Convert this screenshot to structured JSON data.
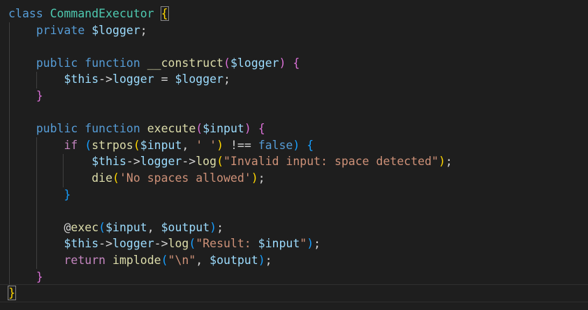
{
  "editor": {
    "language": "php",
    "colors": {
      "background": "#1e1e1e",
      "keyword": "#569cd6",
      "class_name": "#4ec9b0",
      "variable": "#9cdcfe",
      "function": "#dcdcaa",
      "string": "#ce9178",
      "control": "#c586c0",
      "bracket_level_1": "#ffd700",
      "bracket_level_2": "#da70d6",
      "bracket_level_3": "#179fff"
    },
    "lines": [
      [
        [
          "kw",
          "class"
        ],
        [
          "plain",
          " "
        ],
        [
          "cls",
          "CommandExecutor"
        ],
        [
          "plain",
          " "
        ],
        [
          "b1",
          "{"
        ]
      ],
      [
        [
          "plain",
          "    "
        ],
        [
          "kw",
          "private"
        ],
        [
          "plain",
          " "
        ],
        [
          "var",
          "$logger"
        ],
        [
          "plain",
          ";"
        ]
      ],
      [],
      [
        [
          "plain",
          "    "
        ],
        [
          "kw",
          "public"
        ],
        [
          "plain",
          " "
        ],
        [
          "kw",
          "function"
        ],
        [
          "plain",
          " "
        ],
        [
          "fn",
          "__construct"
        ],
        [
          "b2",
          "("
        ],
        [
          "var",
          "$logger"
        ],
        [
          "b2",
          ")"
        ],
        [
          "plain",
          " "
        ],
        [
          "b2",
          "{"
        ]
      ],
      [
        [
          "plain",
          "        "
        ],
        [
          "var",
          "$this"
        ],
        [
          "plain",
          "->"
        ],
        [
          "var",
          "logger"
        ],
        [
          "plain",
          " = "
        ],
        [
          "var",
          "$logger"
        ],
        [
          "plain",
          ";"
        ]
      ],
      [
        [
          "plain",
          "    "
        ],
        [
          "b2",
          "}"
        ]
      ],
      [],
      [
        [
          "plain",
          "    "
        ],
        [
          "kw",
          "public"
        ],
        [
          "plain",
          " "
        ],
        [
          "kw",
          "function"
        ],
        [
          "plain",
          " "
        ],
        [
          "fn",
          "execute"
        ],
        [
          "b2",
          "("
        ],
        [
          "var",
          "$input"
        ],
        [
          "b2",
          ")"
        ],
        [
          "plain",
          " "
        ],
        [
          "b2",
          "{"
        ]
      ],
      [
        [
          "plain",
          "        "
        ],
        [
          "ctl",
          "if"
        ],
        [
          "plain",
          " "
        ],
        [
          "b3",
          "("
        ],
        [
          "fn",
          "strpos"
        ],
        [
          "b1",
          "("
        ],
        [
          "var",
          "$input"
        ],
        [
          "plain",
          ", "
        ],
        [
          "str",
          "' '"
        ],
        [
          "b1",
          ")"
        ],
        [
          "plain",
          " !== "
        ],
        [
          "kw",
          "false"
        ],
        [
          "b3",
          ")"
        ],
        [
          "plain",
          " "
        ],
        [
          "b3",
          "{"
        ]
      ],
      [
        [
          "plain",
          "            "
        ],
        [
          "var",
          "$this"
        ],
        [
          "plain",
          "->"
        ],
        [
          "var",
          "logger"
        ],
        [
          "plain",
          "->"
        ],
        [
          "fn",
          "log"
        ],
        [
          "b1",
          "("
        ],
        [
          "str",
          "\"Invalid input: space detected\""
        ],
        [
          "b1",
          ")"
        ],
        [
          "plain",
          ";"
        ]
      ],
      [
        [
          "plain",
          "            "
        ],
        [
          "fn",
          "die"
        ],
        [
          "b1",
          "("
        ],
        [
          "str",
          "'No spaces allowed'"
        ],
        [
          "b1",
          ")"
        ],
        [
          "plain",
          ";"
        ]
      ],
      [
        [
          "plain",
          "        "
        ],
        [
          "b3",
          "}"
        ]
      ],
      [],
      [
        [
          "plain",
          "        "
        ],
        [
          "plain",
          "@"
        ],
        [
          "fn",
          "exec"
        ],
        [
          "b3",
          "("
        ],
        [
          "var",
          "$input"
        ],
        [
          "plain",
          ", "
        ],
        [
          "var",
          "$output"
        ],
        [
          "b3",
          ")"
        ],
        [
          "plain",
          ";"
        ]
      ],
      [
        [
          "plain",
          "        "
        ],
        [
          "var",
          "$this"
        ],
        [
          "plain",
          "->"
        ],
        [
          "var",
          "logger"
        ],
        [
          "plain",
          "->"
        ],
        [
          "fn",
          "log"
        ],
        [
          "b3",
          "("
        ],
        [
          "str",
          "\"Result: "
        ],
        [
          "var",
          "$input"
        ],
        [
          "str",
          "\""
        ],
        [
          "b3",
          ")"
        ],
        [
          "plain",
          ";"
        ]
      ],
      [
        [
          "plain",
          "        "
        ],
        [
          "ctl",
          "return"
        ],
        [
          "plain",
          " "
        ],
        [
          "fn",
          "implode"
        ],
        [
          "b3",
          "("
        ],
        [
          "str",
          "\"\\n\""
        ],
        [
          "plain",
          ", "
        ],
        [
          "var",
          "$output"
        ],
        [
          "b3",
          ")"
        ],
        [
          "plain",
          ";"
        ]
      ],
      [
        [
          "plain",
          "    "
        ],
        [
          "b2",
          "}"
        ]
      ],
      [
        [
          "b1",
          "}"
        ]
      ]
    ]
  }
}
